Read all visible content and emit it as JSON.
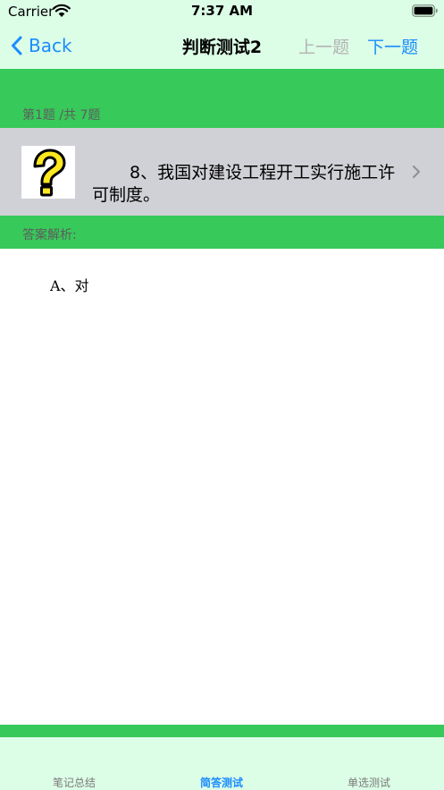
{
  "status_bar": {
    "carrier": "Carrier",
    "time": "7:37 AM",
    "icons": [
      "wifi-icon",
      "battery-icon"
    ]
  },
  "nav": {
    "back_label": "Back",
    "title": "判断测试2",
    "prev_label": "上一题",
    "next_label": "下一题",
    "back_icon": "chevron-left-icon"
  },
  "question": {
    "count": "第1题 /共 7题",
    "text": "8、我国对建设工程开工实行施工许可制度。",
    "icon": "question-mark-icon",
    "disclosure_icon": "chevron-right-icon"
  },
  "analysis": {
    "label": "答案解析:",
    "answer": "A、对"
  },
  "tabs": [
    {
      "label": "笔记总结",
      "active": false
    },
    {
      "label": "简答测试",
      "active": true
    },
    {
      "label": "单选测试",
      "active": false
    }
  ],
  "colors": {
    "accent_blue": "#1a8cff",
    "band_green": "#37c95a",
    "bar_bg": "#dcfde6",
    "row_gray": "#d0d1d6",
    "disabled_gray": "#b3b3b3"
  }
}
